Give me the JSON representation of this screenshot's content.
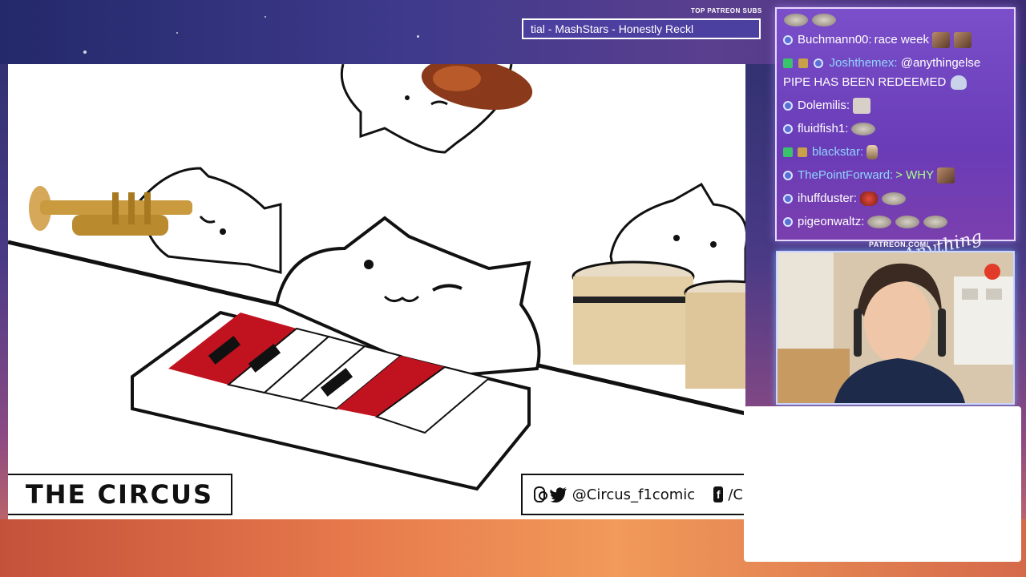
{
  "ticker": {
    "label": "TOP PATREON SUBS",
    "text": "tial - MashStars - Honestly Reckl"
  },
  "chat": {
    "messages": [
      {
        "user": "",
        "message": "",
        "emotes": 2,
        "badges": []
      },
      {
        "user": "Buchmann00:",
        "message": "race week",
        "badges": [
          "sub"
        ],
        "user_color": "white"
      },
      {
        "user": "Joshthemex:",
        "message": "@anythingelse PIPE HAS BEEN REDEEMED",
        "badges": [
          "kick",
          "gift",
          "sub"
        ],
        "user_color": "blue"
      },
      {
        "user": "Dolemilis:",
        "message": "",
        "badges": [
          "sub"
        ],
        "user_color": "white"
      },
      {
        "user": "fluidfish1:",
        "message": "",
        "badges": [
          "sub"
        ],
        "user_color": "white"
      },
      {
        "user": "blackstar:",
        "message": "",
        "badges": [
          "kick",
          "gift"
        ],
        "user_color": "blue"
      },
      {
        "user": "ThePointForward:",
        "message": "> WHY",
        "badges": [
          "sub"
        ],
        "user_color": "blue",
        "message_color": "green"
      },
      {
        "user": "ihuffduster:",
        "message": "",
        "badges": [
          "sub"
        ],
        "user_color": "white"
      },
      {
        "user": "pigeonwaltz:",
        "message": "",
        "badges": [
          "sub"
        ],
        "user_color": "white"
      }
    ]
  },
  "video": {
    "logo": "THE CIRCUS",
    "social_handle": "@Circus_f1comic",
    "social_trailing": "/Ci"
  },
  "branding": {
    "patreon_url": "PATREON.COM/",
    "signature": "Anything Else?"
  },
  "colors": {
    "accent_purple": "#7b4fc9",
    "piano_red": "#c1121f",
    "overlay_orange": "#e77a4c"
  }
}
